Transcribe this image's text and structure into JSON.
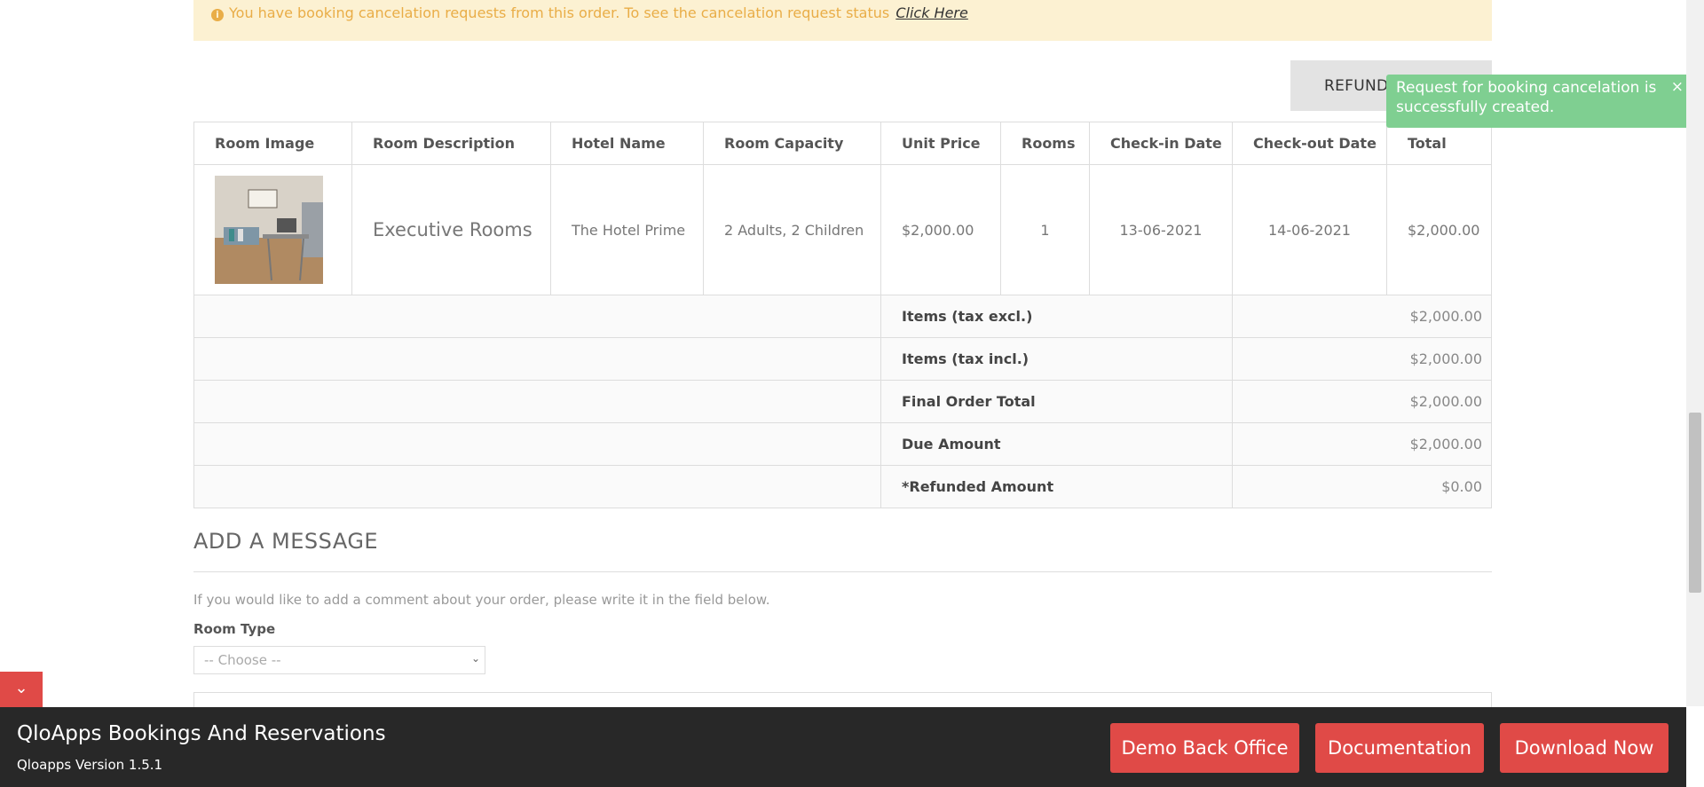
{
  "alert": {
    "icon": "info-circle-icon",
    "message": "You have booking cancelation requests from this order. To see the cancelation request status",
    "link_label": "Click Here",
    "color": "#e9ad47",
    "background": "#fcf1d2"
  },
  "refund_button": {
    "label": "REFUND REQUEST"
  },
  "toast": {
    "message": "Request for booking cancelation is successfully created.",
    "close_label": "×",
    "color": "#7fcf91"
  },
  "table": {
    "headers": [
      "Room Image",
      "Room Description",
      "Hotel Name",
      "Room Capacity",
      "Unit Price",
      "Rooms",
      "Check-in Date",
      "Check-out Date",
      "Total"
    ],
    "row": {
      "room_description": "Executive Rooms",
      "hotel_name": "The Hotel Prime",
      "room_capacity": "2 Adults, 2 Children",
      "unit_price": "$2,000.00",
      "rooms": "1",
      "check_in": "13-06-2021",
      "check_out": "14-06-2021",
      "total": "$2,000.00"
    },
    "totals": [
      {
        "label": "Items (tax excl.)",
        "value": "$2,000.00"
      },
      {
        "label": "Items (tax incl.)",
        "value": "$2,000.00"
      },
      {
        "label": "Final Order Total",
        "value": "$2,000.00"
      },
      {
        "label": "Due Amount",
        "value": "$2,000.00"
      },
      {
        "label": "*Refunded Amount",
        "value": "$0.00"
      }
    ]
  },
  "message_section": {
    "title": "ADD A MESSAGE",
    "hint": "If you would like to add a comment about your order, please write it in the field below.",
    "room_type_label": "Room Type",
    "room_type_selected": "-- Choose --"
  },
  "bottom_bar": {
    "title": "QloApps Bookings And Reservations",
    "version": "Qloapps Version 1.5.1",
    "buttons": [
      "Demo Back Office",
      "Documentation",
      "Download Now"
    ],
    "accent_color": "#e04a47",
    "background": "#282828"
  }
}
